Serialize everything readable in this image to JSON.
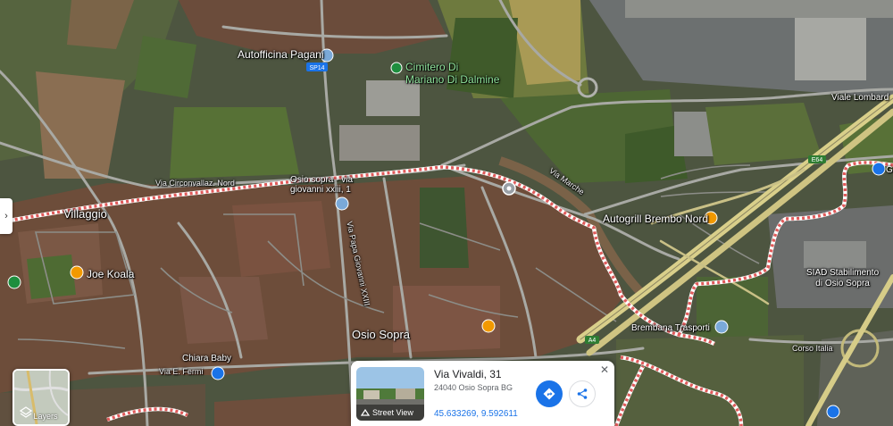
{
  "map": {
    "labels": {
      "autofficina": "Autofficina Pagani",
      "cimitero": "Cimitero Di\nMariano Di Dalmine",
      "sp14": "SP14",
      "viale_lombardia": "Viale Lombard",
      "circonvallaz": "Via Circonvallaz. Nord",
      "osio_giovanni": "Osio sopra - via\ngiovanni xxiii, 1",
      "via_marche": "Via Marche",
      "e64": "E64",
      "autogrill": "Autogrill Brembo Nord",
      "villaggio": "Villaggio",
      "papa_giovanni": "Via Papa Giovanni XXIII",
      "joe_koala": "Joe Koala",
      "siad": "SIAD Stabilimento\ndi Osio Sopra",
      "brembana": "Brembana Trasporti",
      "a4": "A4",
      "osio_sopra": "Osio Sopra",
      "chiara_baby": "Chiara Baby",
      "via_fermi": "Via E. Fermi",
      "corso_italia": "Corso Italia",
      "g_edge": "G"
    }
  },
  "layers_label": "Layers",
  "place_card": {
    "address": "Via Vivaldi, 31",
    "locality": "24040 Osio Sopra BG",
    "coordinates": "45.633269, 9.592611",
    "street_view": "Street View"
  },
  "colors": {
    "boundary": "#e05a5a",
    "google_blue": "#1a73e8",
    "pin_blue": "#7aa9d9",
    "pin_orange": "#f29900",
    "pin_green": "#1e8e3e"
  }
}
